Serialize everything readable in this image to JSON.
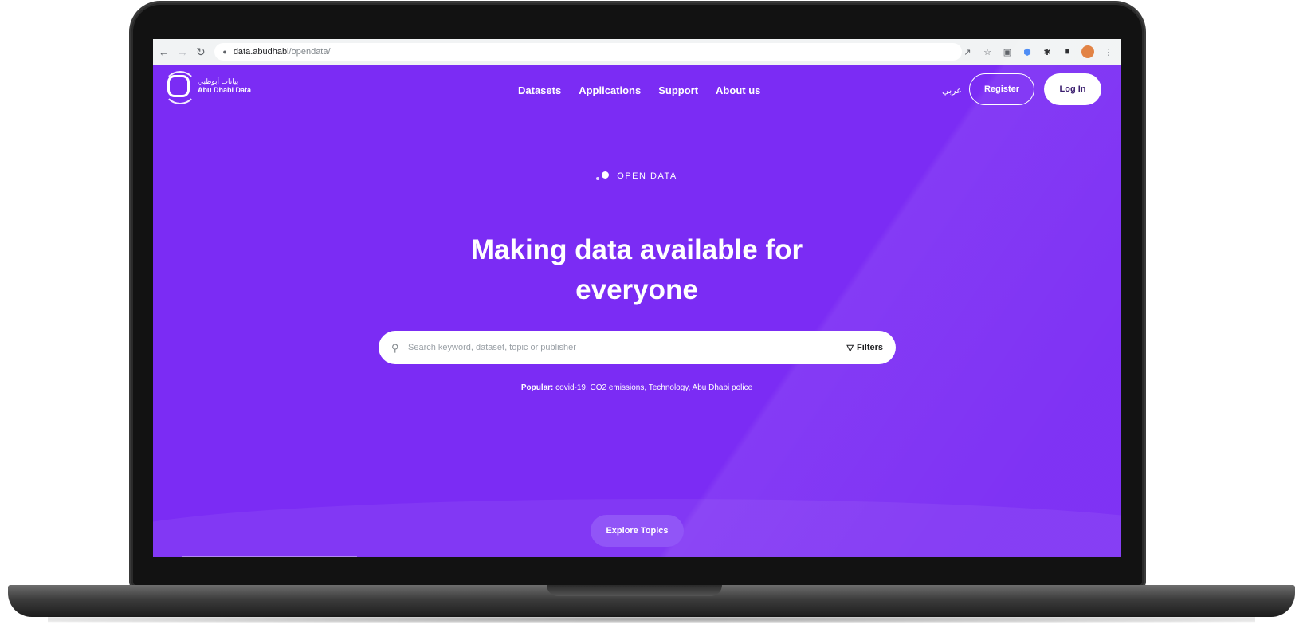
{
  "browser": {
    "url_domain": "data.abudhabi",
    "url_path": "/opendata/",
    "nav_icons": {
      "back": "back-arrow-icon",
      "forward": "forward-arrow-icon",
      "reload": "reload-icon",
      "lock": "lock-icon"
    },
    "toolbar_icons": [
      "share-icon",
      "star-icon",
      "extension-icon",
      "shield-extension-icon",
      "puzzle-icon",
      "sidebar-icon",
      "profile-avatar",
      "more-menu-icon"
    ]
  },
  "site": {
    "logo": {
      "arabic": "بيانات أبوظبي",
      "english_line1": "Abu Dhabi Data"
    },
    "nav": [
      "Datasets",
      "Applications",
      "Support",
      "About us"
    ],
    "language_toggle": "عربي",
    "register_label": "Register",
    "login_label": "Log In"
  },
  "hero": {
    "eyebrow": "OPEN DATA",
    "title_line1": "Making data available for",
    "title_line2": "everyone"
  },
  "search": {
    "placeholder": "Search keyword, dataset, topic or publisher",
    "filters_label": "Filters"
  },
  "popular": {
    "label": "Popular:",
    "items": "covid-19, CO2 emissions, Technology, Abu Dhabi police"
  },
  "explore_label": "Explore Topics",
  "colors": {
    "brand": "#7b2cf4",
    "explore_button": "#9155f7"
  }
}
